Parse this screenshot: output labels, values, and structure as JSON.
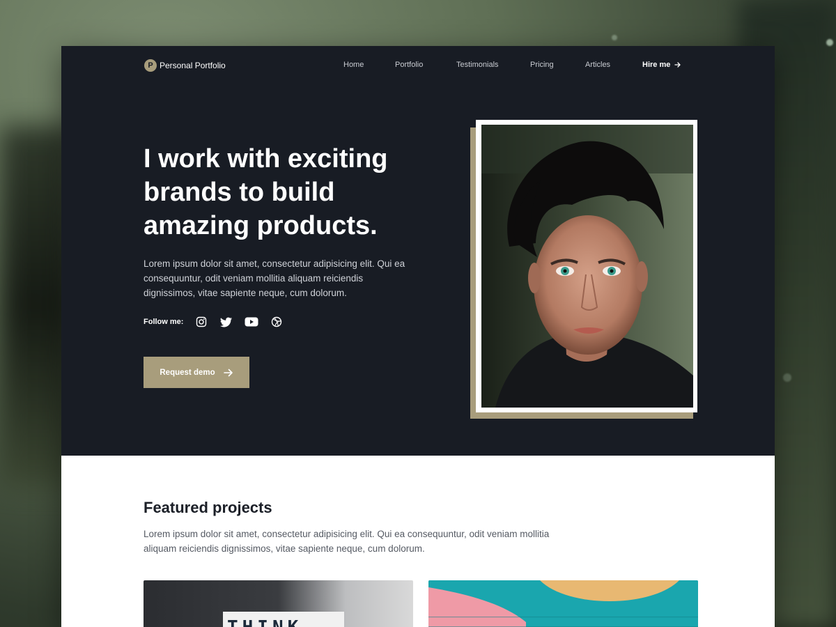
{
  "brand": {
    "mark": "P",
    "name": "Personal Portfolio"
  },
  "nav": {
    "items": [
      {
        "label": "Home"
      },
      {
        "label": "Portfolio"
      },
      {
        "label": "Testimonials"
      },
      {
        "label": "Pricing"
      },
      {
        "label": "Articles"
      }
    ],
    "cta_label": "Hire me",
    "cta_icon": "arrow-right-icon"
  },
  "hero": {
    "title": "I work with exciting brands to build amazing products.",
    "description": "Lorem ipsum dolor sit amet, consectetur adipisicing elit. Qui ea consequuntur, odit veniam mollitia aliquam reiciendis dignissimos, vitae sapiente neque, cum dolorum.",
    "follow_label": "Follow me:",
    "socials": [
      "instagram-icon",
      "twitter-icon",
      "youtube-icon",
      "dribbble-icon"
    ],
    "cta_label": "Request demo",
    "cta_icon": "arrow-right-icon"
  },
  "projects": {
    "title": "Featured projects",
    "description": "Lorem ipsum dolor sit amet, consectetur adipisicing elit. Qui ea consequuntur, odit veniam mollitia aliquam reiciendis dignissimos, vitae sapiente neque, cum dolorum.",
    "card1_text": "THINK"
  },
  "colors": {
    "hero_bg": "#181c24",
    "accent": "#a89d7c",
    "page_bg": "#ffffff",
    "heading_dark": "#1b1f27"
  }
}
